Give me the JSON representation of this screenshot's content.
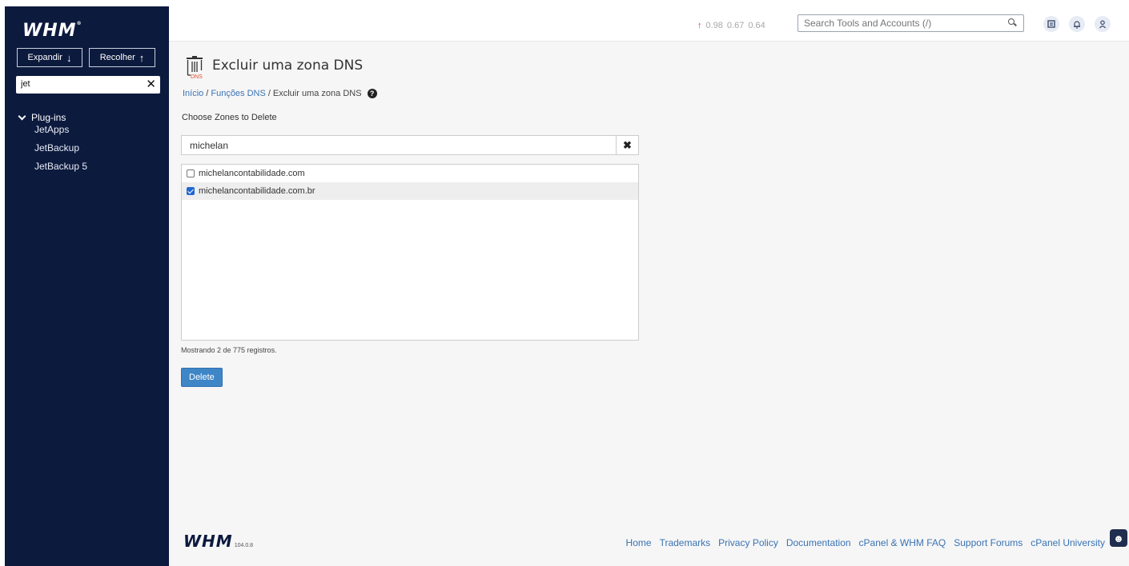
{
  "brand": {
    "logo_text": "WHM"
  },
  "sidebar": {
    "expand_label": "Expandir",
    "collapse_label": "Recolher",
    "search_value": "jet",
    "section_label": "Plug-ins",
    "items": [
      {
        "label": "JetApps"
      },
      {
        "label": "JetBackup"
      },
      {
        "label": "JetBackup 5"
      }
    ]
  },
  "topbar": {
    "load_averages": [
      "0.98",
      "0.67",
      "0.64"
    ],
    "search_placeholder": "Search Tools and Accounts (/)",
    "icons": [
      "search-icon",
      "notes-icon",
      "bell-icon",
      "user-icon"
    ]
  },
  "page": {
    "icon_text": "DNS",
    "title": "Excluir uma zona DNS",
    "breadcrumb": {
      "home": "Início",
      "parent": "Funções DNS",
      "current": "Excluir uma zona DNS"
    },
    "section_label": "Choose Zones to Delete",
    "filter_value": "michelan",
    "zones": [
      {
        "label": "michelancontabilidade.com",
        "checked": false
      },
      {
        "label": "michelancontabilidade.com.br",
        "checked": true
      }
    ],
    "count_text": "Mostrando 2 de 775 registros.",
    "delete_label": "Delete"
  },
  "footer": {
    "version": "104.0.8",
    "links": [
      "Home",
      "Trademarks",
      "Privacy Policy",
      "Documentation",
      "cPanel & WHM FAQ",
      "Support Forums",
      "cPanel University"
    ]
  },
  "colors": {
    "sidebar_bg": "#0c1a3e",
    "link": "#3a73b4",
    "button": "#3f86c7",
    "load_up_arrow": "#d9364a"
  }
}
